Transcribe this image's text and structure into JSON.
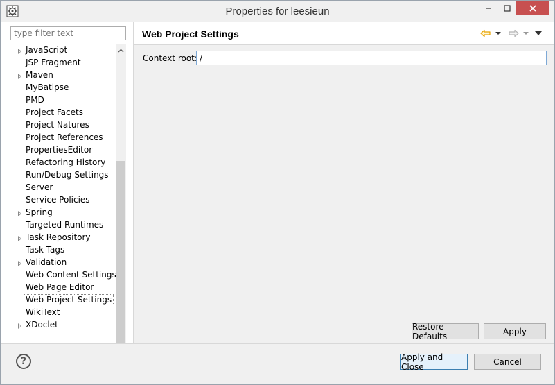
{
  "window": {
    "title": "Properties for leesieun"
  },
  "filter": {
    "placeholder": "type filter text"
  },
  "tree": {
    "items": [
      {
        "label": "JavaScript",
        "expandable": true
      },
      {
        "label": "JSP Fragment",
        "expandable": false
      },
      {
        "label": "Maven",
        "expandable": true
      },
      {
        "label": "MyBatipse",
        "expandable": false
      },
      {
        "label": "PMD",
        "expandable": false
      },
      {
        "label": "Project Facets",
        "expandable": false
      },
      {
        "label": "Project Natures",
        "expandable": false
      },
      {
        "label": "Project References",
        "expandable": false
      },
      {
        "label": "PropertiesEditor",
        "expandable": false
      },
      {
        "label": "Refactoring History",
        "expandable": false
      },
      {
        "label": "Run/Debug Settings",
        "expandable": false
      },
      {
        "label": "Server",
        "expandable": false
      },
      {
        "label": "Service Policies",
        "expandable": false
      },
      {
        "label": "Spring",
        "expandable": true
      },
      {
        "label": "Targeted Runtimes",
        "expandable": false
      },
      {
        "label": "Task Repository",
        "expandable": true
      },
      {
        "label": "Task Tags",
        "expandable": false
      },
      {
        "label": "Validation",
        "expandable": true
      },
      {
        "label": "Web Content Settings",
        "expandable": false
      },
      {
        "label": "Web Page Editor",
        "expandable": false
      },
      {
        "label": "Web Project Settings",
        "expandable": false,
        "selected": true
      },
      {
        "label": "WikiText",
        "expandable": false
      },
      {
        "label": "XDoclet",
        "expandable": true
      }
    ]
  },
  "page": {
    "title": "Web Project Settings",
    "context_root_label": "Context root:",
    "context_root_value": "/",
    "restore_defaults_label": "Restore Defaults",
    "apply_label": "Apply"
  },
  "footer": {
    "apply_close_label": "Apply and Close",
    "cancel_label": "Cancel"
  },
  "colors": {
    "close_button": "#c75050",
    "back_arrow": "#e8a200",
    "default_button_border": "#3c7fb1"
  }
}
